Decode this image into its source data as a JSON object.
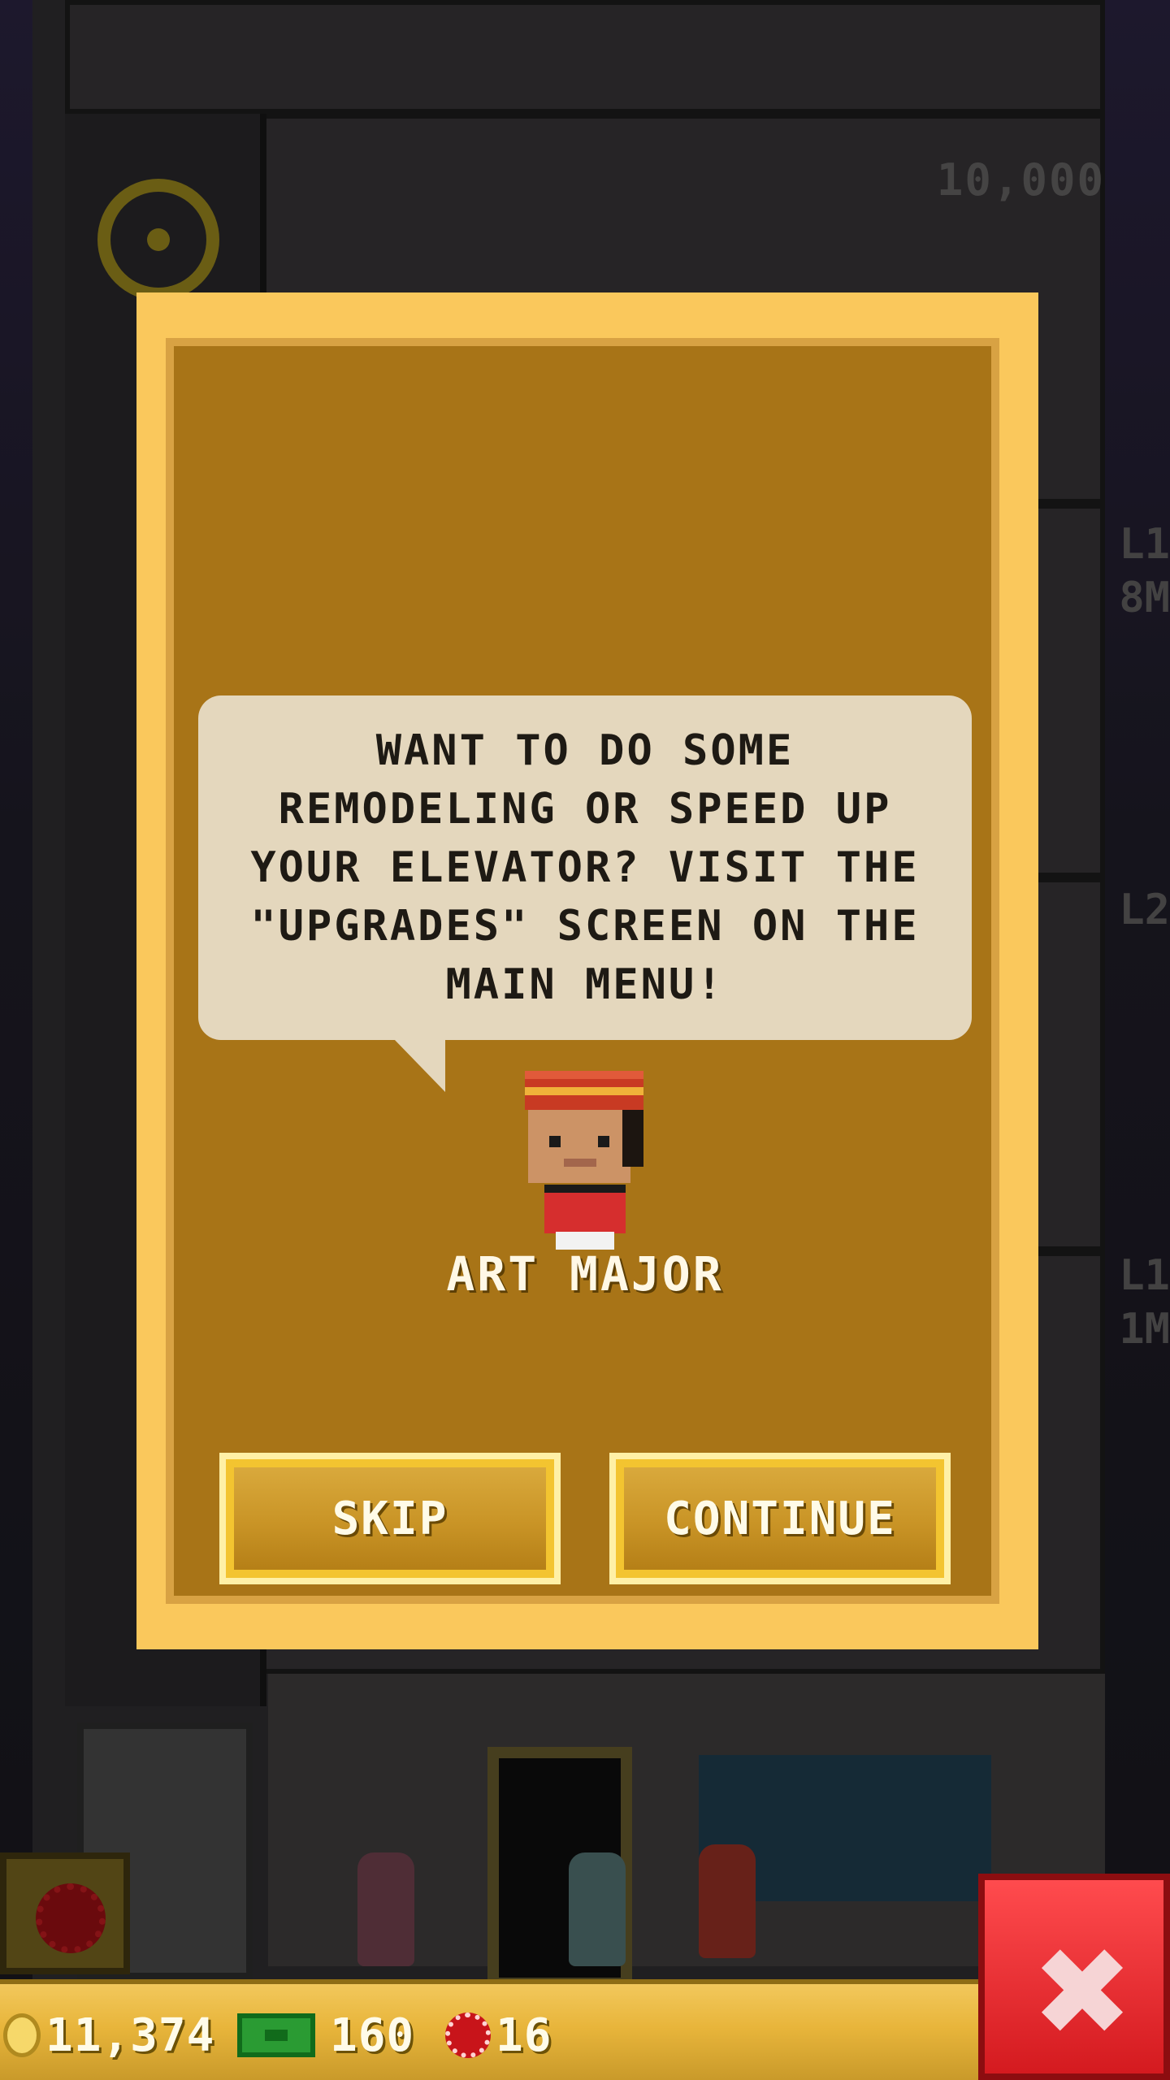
{
  "background": {
    "price_label": "10,000",
    "floor_tags": [
      "L1",
      "8M",
      "L2",
      "L1",
      "1M"
    ]
  },
  "dialog": {
    "message": "WANT TO DO SOME REMODELING OR SPEED UP YOUR ELEVATOR? VISIT THE \"UPGRADES\" SCREEN ON THE MAIN MENU!",
    "character_name": "ART MAJOR",
    "buttons": {
      "skip": "SKIP",
      "continue": "CONTINUE"
    }
  },
  "currency": {
    "coins": "11,374",
    "bux": "160",
    "gems": "16"
  },
  "colors": {
    "dialog_border": "#fac85c",
    "dialog_panel": "#a87417",
    "bubble": "#e4d7bd",
    "close_button": "#e52a2f"
  },
  "icons": {
    "coin": "coin-icon",
    "bux": "bux-icon",
    "gem": "gem-icon",
    "close": "close-icon"
  }
}
